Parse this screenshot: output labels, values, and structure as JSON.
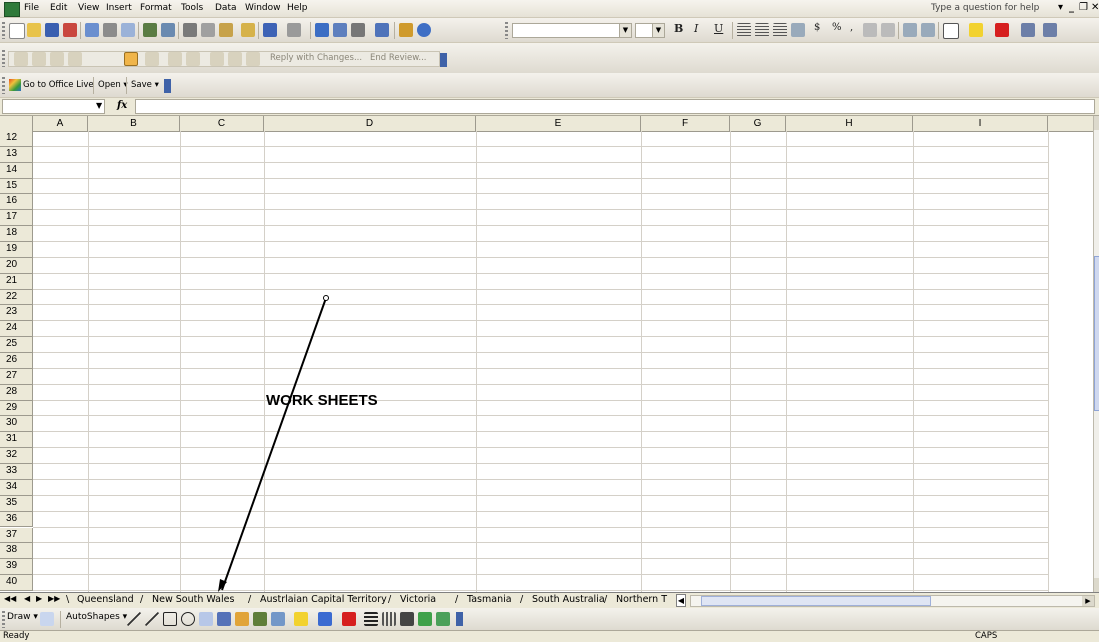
{
  "menu": {
    "items": [
      {
        "label": "File",
        "u": "F"
      },
      {
        "label": "Edit",
        "u": "E"
      },
      {
        "label": "View",
        "u": "V"
      },
      {
        "label": "Insert",
        "u": "I"
      },
      {
        "label": "Format",
        "u": "o"
      },
      {
        "label": "Tools",
        "u": "T"
      },
      {
        "label": "Data",
        "u": "D"
      },
      {
        "label": "Window",
        "u": "W"
      },
      {
        "label": "Help",
        "u": "H"
      }
    ],
    "help_placeholder": "Type a question for help"
  },
  "review_toolbar": {
    "reply_label": "Reply with Changes...",
    "end_review_label": "End Review..."
  },
  "office_toolbar": {
    "go_to_office_live": "Go to Office Live",
    "open_label": "Open",
    "save_label": "Save"
  },
  "formula_bar": {
    "fx": "fx",
    "name_box_value": "",
    "formula_value": ""
  },
  "columns": [
    "A",
    "B",
    "C",
    "D",
    "E",
    "F",
    "G",
    "H",
    "I"
  ],
  "rows": [
    "12",
    "13",
    "14",
    "15",
    "16",
    "17",
    "18",
    "19",
    "20",
    "21",
    "22",
    "23",
    "24",
    "25",
    "26",
    "27",
    "28",
    "29",
    "30",
    "31",
    "32",
    "33",
    "34",
    "35",
    "36",
    "37",
    "38",
    "39",
    "40"
  ],
  "callout": {
    "text": "WORK SHEETS"
  },
  "sheet_tabs": [
    "Queensland",
    "New South Wales",
    "Austrlaian Capital Territory",
    "Victoria",
    "Tasmania",
    "South Australia",
    "Northern T"
  ],
  "draw_toolbar": {
    "draw_label": "Draw",
    "autoshapes_label": "AutoShapes"
  },
  "status": {
    "left": "Ready",
    "right": "CAPS"
  },
  "colors": {
    "toolbar_bg": "#e6e2d6",
    "grid_line": "#d4d0c8",
    "header_bg": "#ece9d8"
  }
}
